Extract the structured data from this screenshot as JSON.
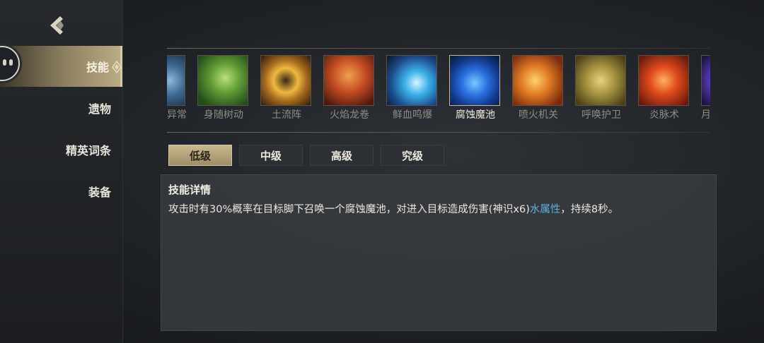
{
  "sidebar": {
    "items": [
      {
        "label": "技能",
        "active": true
      },
      {
        "label": "遗物",
        "active": false
      },
      {
        "label": "精英词条",
        "active": false
      },
      {
        "label": "装备",
        "active": false
      }
    ]
  },
  "skills": [
    {
      "name": "异常",
      "icon": "ice-swirl-icon"
    },
    {
      "name": "身随树动",
      "icon": "leaf-figure-icon"
    },
    {
      "name": "土流阵",
      "icon": "earth-vortex-icon"
    },
    {
      "name": "火焰龙卷",
      "icon": "fire-tornado-icon"
    },
    {
      "name": "鲜血鸣爆",
      "icon": "blood-blast-icon"
    },
    {
      "name": "腐蚀魔池",
      "icon": "corrosion-pool-icon",
      "selected": true
    },
    {
      "name": "喷火机关",
      "icon": "flame-cannon-icon"
    },
    {
      "name": "呼唤护卫",
      "icon": "summon-guard-icon"
    },
    {
      "name": "炎脉术",
      "icon": "flame-vein-icon"
    },
    {
      "name": "月",
      "icon": "purple-orb-icon"
    }
  ],
  "levels": [
    {
      "label": "低级",
      "active": true
    },
    {
      "label": "中级",
      "active": false
    },
    {
      "label": "高级",
      "active": false
    },
    {
      "label": "究级",
      "active": false
    }
  ],
  "detail": {
    "title": "技能详情",
    "text_before": "攻击时有30%概率在目标脚下召唤一个腐蚀魔池，对进入目标造成伤害(神识x6)",
    "element": "水属性",
    "text_after": "，持续8秒。"
  },
  "colors": {
    "accent_gold": "#c9b88d",
    "element_blue": "#5fb0e0",
    "panel_bg": "#3a3e43"
  }
}
